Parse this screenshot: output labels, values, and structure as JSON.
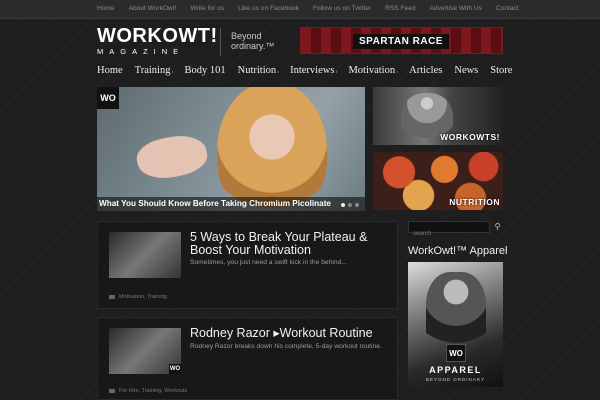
{
  "topnav": [
    "Home",
    "About WorkOwt!",
    "Write for us",
    "Like us on Facebook",
    "Follow us on Twitter",
    "RSS Feed",
    "Advertise With Us",
    "Contact"
  ],
  "header": {
    "logo_main": "WORKOWT!",
    "logo_sub": "MAGAZINE",
    "tagline": "Beyond ordinary.™",
    "banner_text": "SPARTAN RACE"
  },
  "nav": [
    {
      "label": "Home",
      "chevron": ""
    },
    {
      "label": "Training",
      "chevron": "›"
    },
    {
      "label": "Body 101",
      "chevron": ""
    },
    {
      "label": "Nutrition",
      "chevron": "›"
    },
    {
      "label": "Interviews",
      "chevron": "›"
    },
    {
      "label": "Motivation",
      "chevron": "›"
    },
    {
      "label": "Articles",
      "chevron": ""
    },
    {
      "label": "News",
      "chevron": ""
    },
    {
      "label": "Store",
      "chevron": ""
    }
  ],
  "hero": {
    "badge": "WO",
    "caption": "What You Should Know Before Taking Chromium Picolinate"
  },
  "tiles": [
    "WORKOWTS!",
    "NUTRITION"
  ],
  "posts": [
    {
      "title": "5 Ways to Break Your Plateau & Boost Your Motivation",
      "excerpt": "Sometimes, you just need a swift kick in the behind...",
      "meta": "Motivation, Training"
    },
    {
      "title": "Rodney Razor ▸Workout Routine",
      "excerpt": "Rodney Razor breaks down his complete, 5-day workout routine.",
      "meta": "For Him, Training, Workouts"
    }
  ],
  "sidebar": {
    "search_placeholder": "search",
    "search_icon": "magnifier-icon",
    "title": "WorkOwt!™ Apparel",
    "apparel_badge": "WO",
    "apparel_word": "APPAREL",
    "apparel_tag": "BEYOND ORDINARY"
  }
}
